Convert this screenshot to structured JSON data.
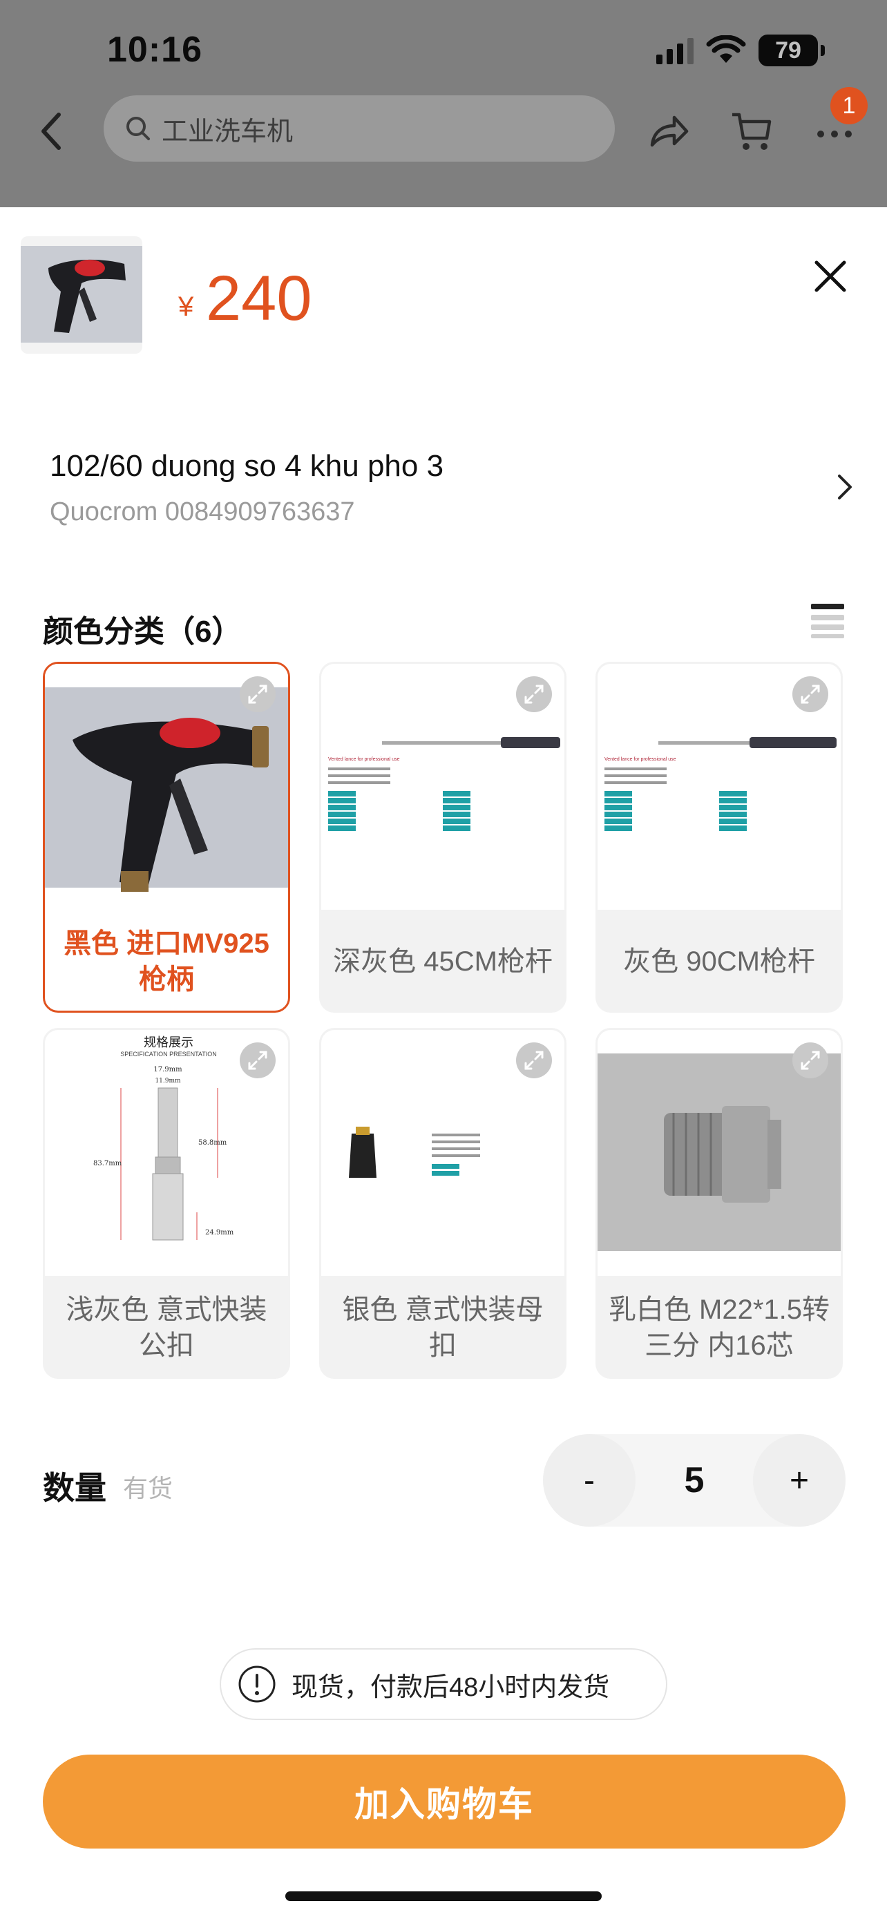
{
  "status_bar": {
    "time": "10:16",
    "battery": "79"
  },
  "nav": {
    "search_placeholder": "工业洗车机",
    "cart_badge": "1",
    "icons": [
      "back-icon",
      "search-icon",
      "share-icon",
      "cart-icon",
      "more-icon"
    ]
  },
  "product": {
    "price_symbol": "¥",
    "price": "240"
  },
  "address": {
    "line1": "102/60 duong so 4 khu pho 3",
    "line2": "Quocrom 0084909763637"
  },
  "variants": {
    "title": "颜色分类（6）",
    "items": [
      {
        "label": "黑色 进口MV925枪柄",
        "selected": true,
        "image": "black-spray-gun-handle"
      },
      {
        "label": "深灰色 45CM枪杆",
        "selected": false,
        "image": "lance-spec-sheet"
      },
      {
        "label": "灰色 90CM枪杆",
        "selected": false,
        "image": "lance-spec-sheet"
      },
      {
        "label": "浅灰色 意式快装公扣",
        "selected": false,
        "image": "male-quick-coupler-spec"
      },
      {
        "label": "银色 意式快装母扣",
        "selected": false,
        "image": "female-quick-coupler"
      },
      {
        "label": "乳白色 M22*1.5转三分 内16芯",
        "selected": false,
        "image": "m22-adapter-fitting"
      }
    ],
    "spec_image_texts": {
      "lance_heading": "Vented lance for professional use",
      "coupler_heading": "规格展示",
      "coupler_sub": "SPECIFICATION PRESENTATION",
      "coupler_dims": [
        "17.9mm",
        "11.9mm",
        "83.7mm",
        "58.8mm",
        "24.9mm"
      ]
    }
  },
  "quantity": {
    "label": "数量",
    "stock": "有货",
    "minus": "-",
    "value": "5",
    "plus": "+"
  },
  "notice": {
    "text": "现货，付款后48小时内发货"
  },
  "cta": {
    "label": "加入购物车"
  },
  "colors": {
    "accent": "#e0521f",
    "cta": "#f39a36",
    "overlay": "#7f7f7f"
  }
}
